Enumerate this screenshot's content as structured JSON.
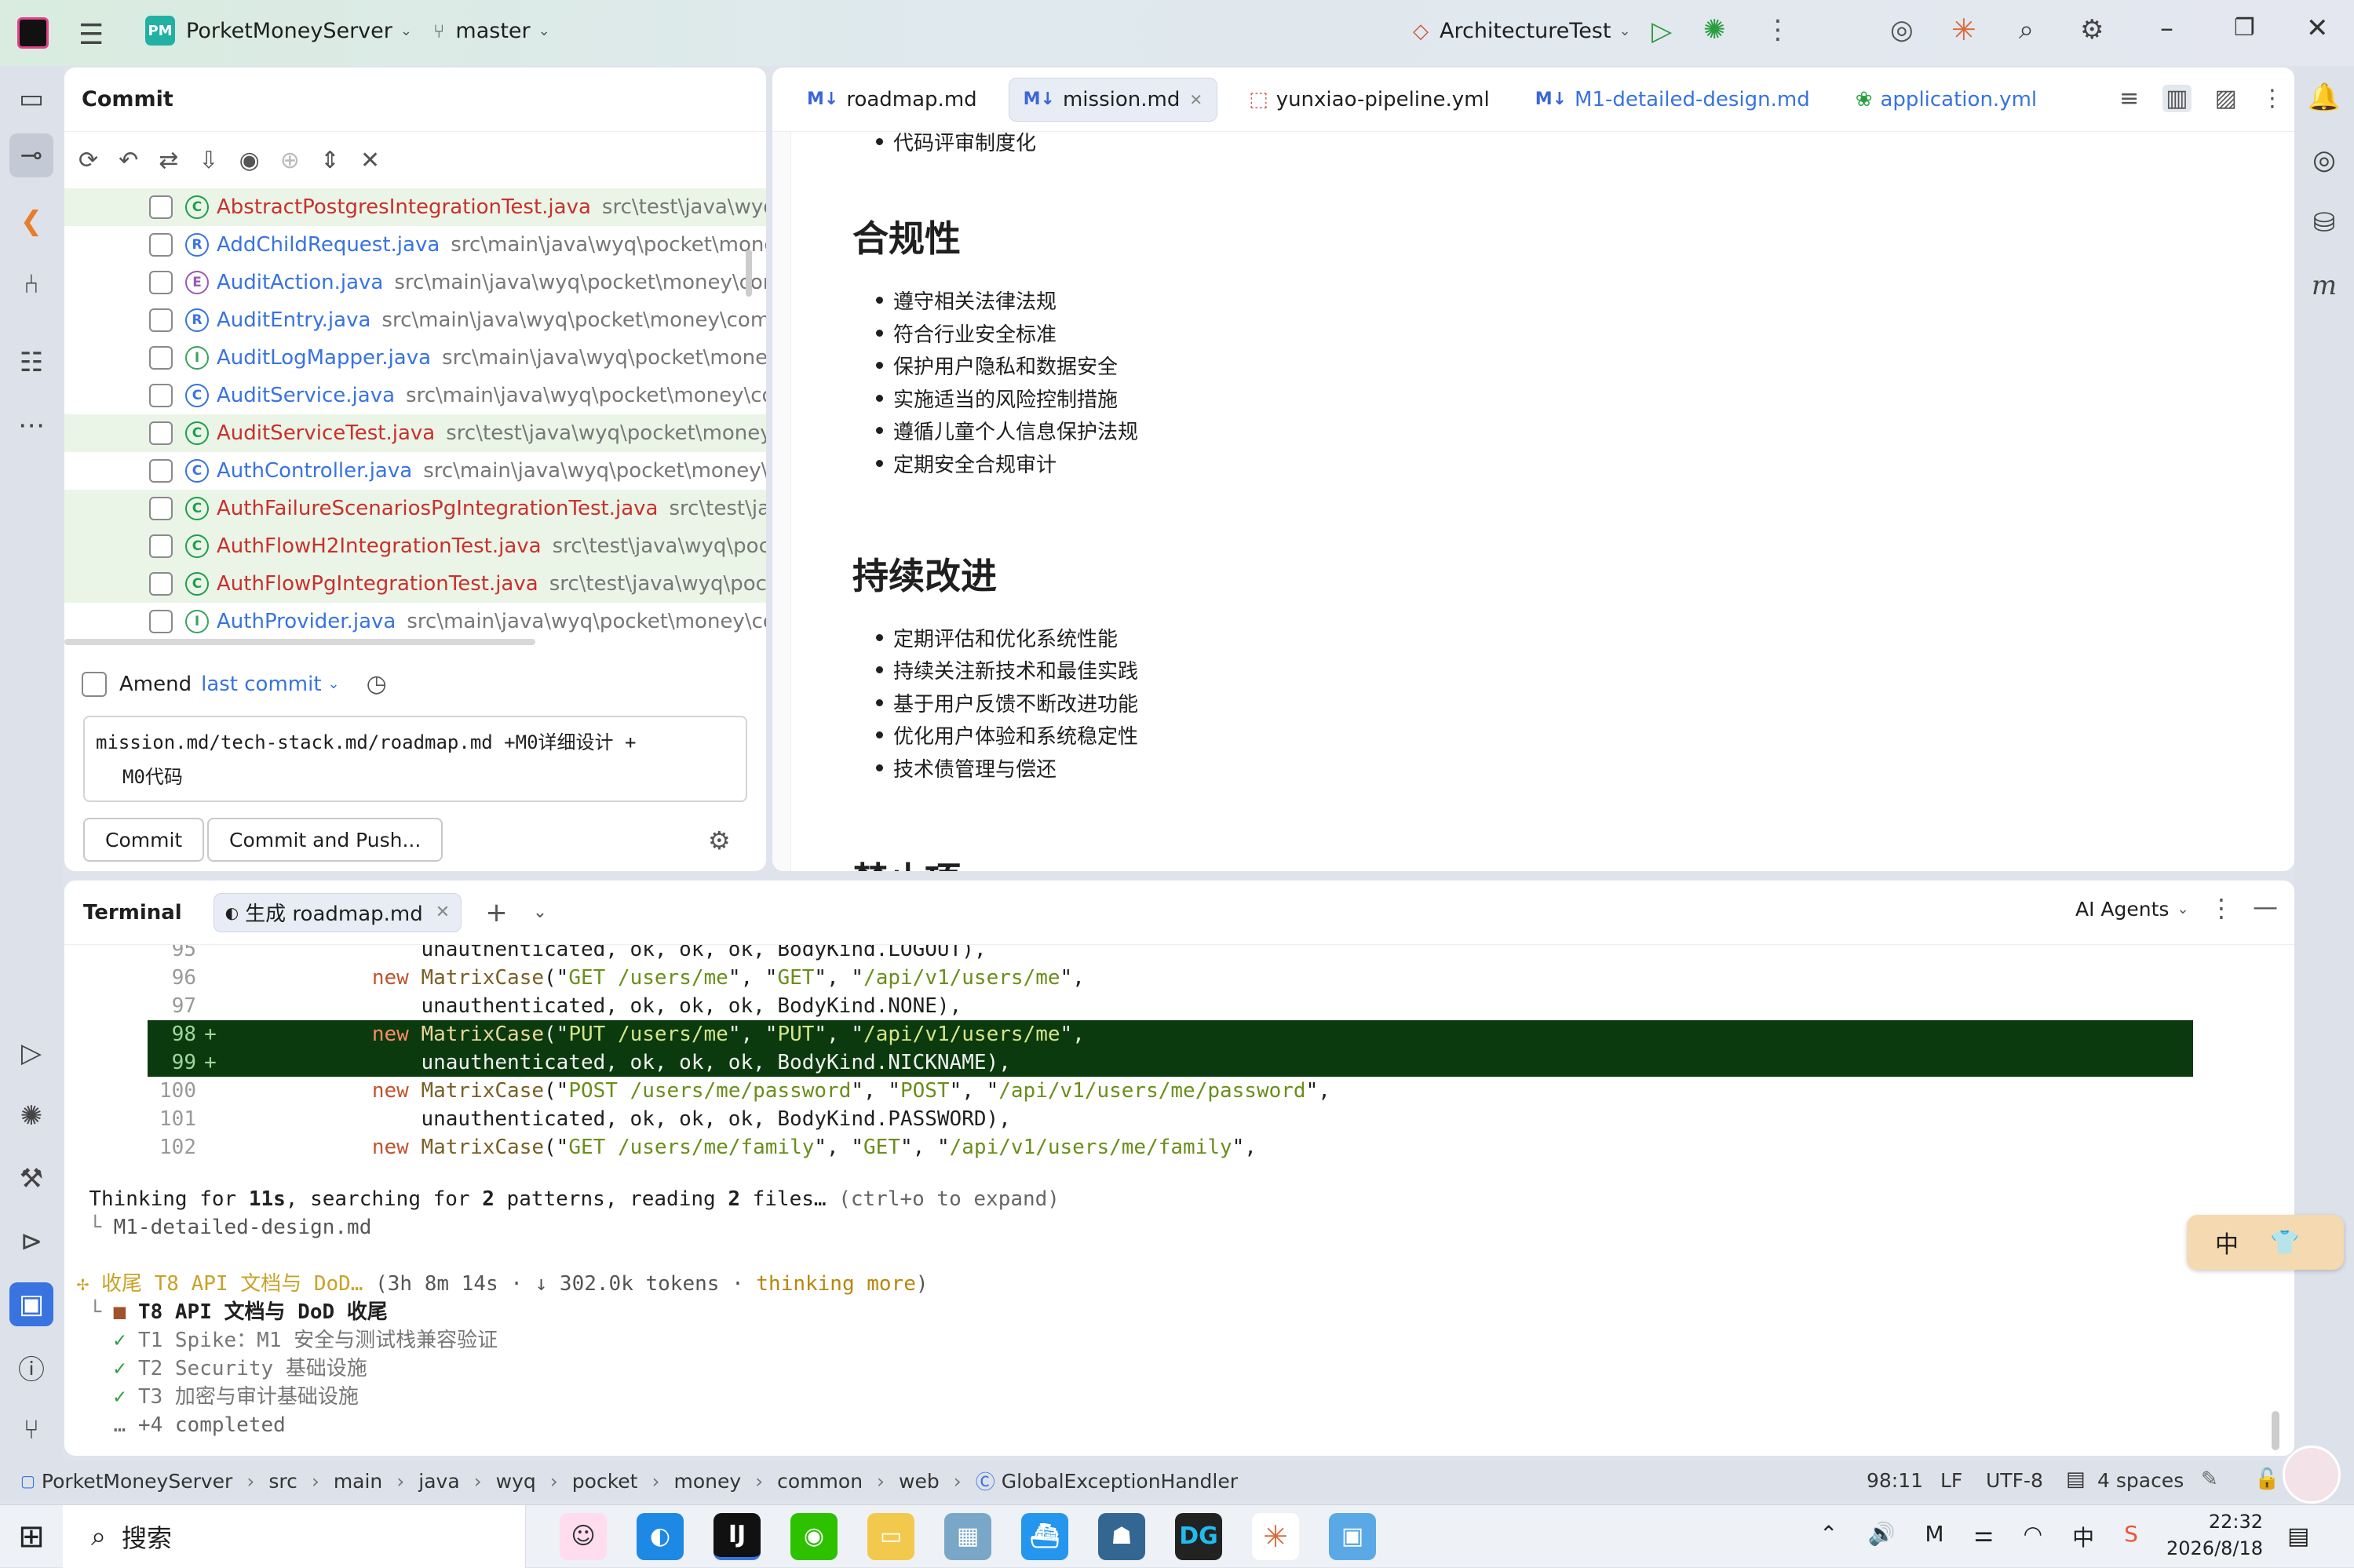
{
  "titlebar": {
    "project_badge": "PM",
    "project_name": "PorketMoneyServer",
    "branch": "master",
    "run_config": "ArchitectureTest"
  },
  "commit": {
    "title": "Commit",
    "files": [
      {
        "name": "AbstractPostgresIntegrationTest.java",
        "path": "src\\test\\java\\wyq\\pocke",
        "icon": "C",
        "changed": true,
        "test": true
      },
      {
        "name": "AddChildRequest.java",
        "path": "src\\main\\java\\wyq\\pocket\\money\\use",
        "icon": "R",
        "changed": false
      },
      {
        "name": "AuditAction.java",
        "path": "src\\main\\java\\wyq\\pocket\\money\\common\\",
        "icon": "E",
        "changed": false
      },
      {
        "name": "AuditEntry.java",
        "path": "src\\main\\java\\wyq\\pocket\\money\\common\\a",
        "icon": "R",
        "changed": false
      },
      {
        "name": "AuditLogMapper.java",
        "path": "src\\main\\java\\wyq\\pocket\\money\\com",
        "icon": "I",
        "changed": false
      },
      {
        "name": "AuditService.java",
        "path": "src\\main\\java\\wyq\\pocket\\money\\common",
        "icon": "C",
        "changed": false
      },
      {
        "name": "AuditServiceTest.java",
        "path": "src\\test\\java\\wyq\\pocket\\money\\comm",
        "icon": "C",
        "changed": true,
        "test": true
      },
      {
        "name": "AuthController.java",
        "path": "src\\main\\java\\wyq\\pocket\\money\\user\\c",
        "icon": "C",
        "changed": false
      },
      {
        "name": "AuthFailureScenariosPgIntegrationTest.java",
        "path": "src\\test\\java\\wyq",
        "icon": "C",
        "changed": true,
        "test": true
      },
      {
        "name": "AuthFlowH2IntegrationTest.java",
        "path": "src\\test\\java\\wyq\\pocket\\m",
        "icon": "C",
        "changed": true,
        "test": true
      },
      {
        "name": "AuthFlowPgIntegrationTest.java",
        "path": "src\\test\\java\\wyq\\pocket\\mo",
        "icon": "C",
        "changed": true,
        "test": true
      },
      {
        "name": "AuthProvider.java",
        "path": "src\\main\\java\\wyq\\pocket\\money\\commo",
        "icon": "I",
        "changed": false
      }
    ],
    "amend_label": "Amend",
    "last_commit_label": "last commit",
    "message_line1": "mission.md/tech-stack.md/roadmap.md +M0详细设计 +",
    "message_line2": "M0代码",
    "commit_button": "Commit",
    "commit_push_button": "Commit and Push..."
  },
  "editor": {
    "tabs": [
      {
        "label": "roadmap.md",
        "kind": "md",
        "active": false
      },
      {
        "label": "mission.md",
        "kind": "md",
        "active": true
      },
      {
        "label": "yunxiao-pipeline.yml",
        "kind": "yml-red",
        "active": false
      },
      {
        "label": "M1-detailed-design.md",
        "kind": "md",
        "active": false
      },
      {
        "label": "application.yml",
        "kind": "yml-green",
        "active": false
      }
    ],
    "cut_line": "代码评审制度化",
    "sections": [
      {
        "heading": "合规性",
        "items": [
          "遵守相关法律法规",
          "符合行业安全标准",
          "保护用户隐私和数据安全",
          "实施适当的风险控制措施",
          "遵循儿童个人信息保护法规",
          "定期安全合规审计"
        ]
      },
      {
        "heading": "持续改进",
        "items": [
          "定期评估和优化系统性能",
          "持续关注新技术和最佳实践",
          "基于用户反馈不断改进功能",
          "优化用户体验和系统稳定性",
          "技术债管理与偿还"
        ]
      },
      {
        "heading": "禁止项",
        "items": []
      }
    ]
  },
  "terminal": {
    "title": "Terminal",
    "tab_label": "生成 roadmap.md",
    "ai_agents": "AI Agents",
    "code_lines": [
      {
        "num": "95",
        "mark": "",
        "pre": "                unauthenticated, ok, ok, ok, BodyKind.LOGOUT),",
        "added": false,
        "kind": "plain"
      },
      {
        "num": "96",
        "mark": "",
        "method": "GET /users/me",
        "verb": "GET",
        "url": "/api/v1/users/me",
        "added": false,
        "kind": "case"
      },
      {
        "num": "97",
        "mark": "",
        "pre": "                unauthenticated, ok, ok, ok, BodyKind.NONE),",
        "added": false,
        "kind": "plain"
      },
      {
        "num": "98",
        "mark": "+",
        "method": "PUT /users/me",
        "verb": "PUT",
        "url": "/api/v1/users/me",
        "added": true,
        "kind": "case"
      },
      {
        "num": "99",
        "mark": "+",
        "pre": "                unauthenticated, ok, ok, ok, BodyKind.NICKNAME),",
        "added": true,
        "kind": "plain"
      },
      {
        "num": "100",
        "mark": "",
        "method": "POST /users/me/password",
        "verb": "POST",
        "url": "/api/v1/users/me/password",
        "added": false,
        "kind": "case"
      },
      {
        "num": "101",
        "mark": "",
        "pre": "                unauthenticated, ok, ok, ok, BodyKind.PASSWORD),",
        "added": false,
        "kind": "plain"
      },
      {
        "num": "102",
        "mark": "",
        "method": "GET /users/me/family",
        "verb": "GET",
        "url": "/api/v1/users/me/family",
        "added": false,
        "kind": "case"
      }
    ],
    "thinking_a": "Thinking for ",
    "thinking_b": "11s",
    "thinking_c": ", searching for ",
    "thinking_d": "2",
    "thinking_e": " patterns, reading ",
    "thinking_f": "2",
    "thinking_g": " files…",
    "thinking_hint": "(ctrl+o to expand)",
    "file_ref": "M1-detailed-design.md",
    "task_title": "收尾 T8 API 文档与 DoD…",
    "task_stats": "(3h 8m 14s · ↓ 302.0k tokens · ",
    "task_thinking": "thinking more",
    "task_close": ")",
    "current_task": "T8 API 文档与 DoD 收尾",
    "done_tasks": [
      "T1 Spike：M1 安全与测试栈兼容验证",
      "T2 Security 基础设施",
      "T3 加密与审计基础设施"
    ],
    "more_completed": "… +4 completed"
  },
  "ime": {
    "label": "中"
  },
  "statusbar": {
    "breadcrumbs": [
      "PorketMoneyServer",
      "src",
      "main",
      "java",
      "wyq",
      "pocket",
      "money",
      "common",
      "web",
      "GlobalExceptionHandler"
    ],
    "position": "98:11",
    "line_ending": "LF",
    "encoding": "UTF-8",
    "indent": "4 spaces"
  },
  "taskbar": {
    "search": "搜索",
    "time": "22:32",
    "date": "2026/8/18"
  },
  "colors": {
    "accent": "#3873e0",
    "added_bg": "#0b3a0e",
    "changed_file": "#c9302c",
    "test_file_icon": "#1f9e4d"
  }
}
